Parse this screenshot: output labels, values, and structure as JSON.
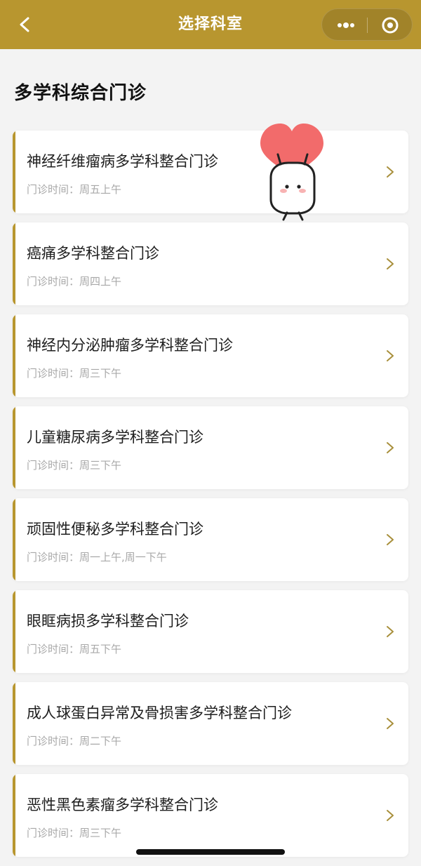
{
  "header": {
    "title": "选择科室",
    "back_icon": "chevron-left-icon",
    "more_icon": "more-dots-icon",
    "close_icon": "target-close-icon"
  },
  "section": {
    "title": "多学科综合门诊"
  },
  "clinics": [
    {
      "name": "神经纤维瘤病多学科整合门诊",
      "time": "门诊时间：周五上午"
    },
    {
      "name": "癌痛多学科整合门诊",
      "time": "门诊时间：周四上午"
    },
    {
      "name": "神经内分泌肿瘤多学科整合门诊",
      "time": "门诊时间：周三下午"
    },
    {
      "name": "儿童糖尿病多学科整合门诊",
      "time": "门诊时间：周三下午"
    },
    {
      "name": "顽固性便秘多学科整合门诊",
      "time": "门诊时间：周一上午,周一下午"
    },
    {
      "name": "眼眶病损多学科整合门诊",
      "time": "门诊时间：周五下午"
    },
    {
      "name": "成人球蛋白异常及骨损害多学科整合门诊",
      "time": "门诊时间：周二下午"
    },
    {
      "name": "恶性黑色素瘤多学科整合门诊",
      "time": "门诊时间：周三下午"
    }
  ],
  "colors": {
    "accent": "#b8962f",
    "background": "#f3f3f3",
    "card": "#ffffff",
    "heart": "#f26b6b"
  },
  "decoration": {
    "icon": "heart-mascot-icon"
  }
}
